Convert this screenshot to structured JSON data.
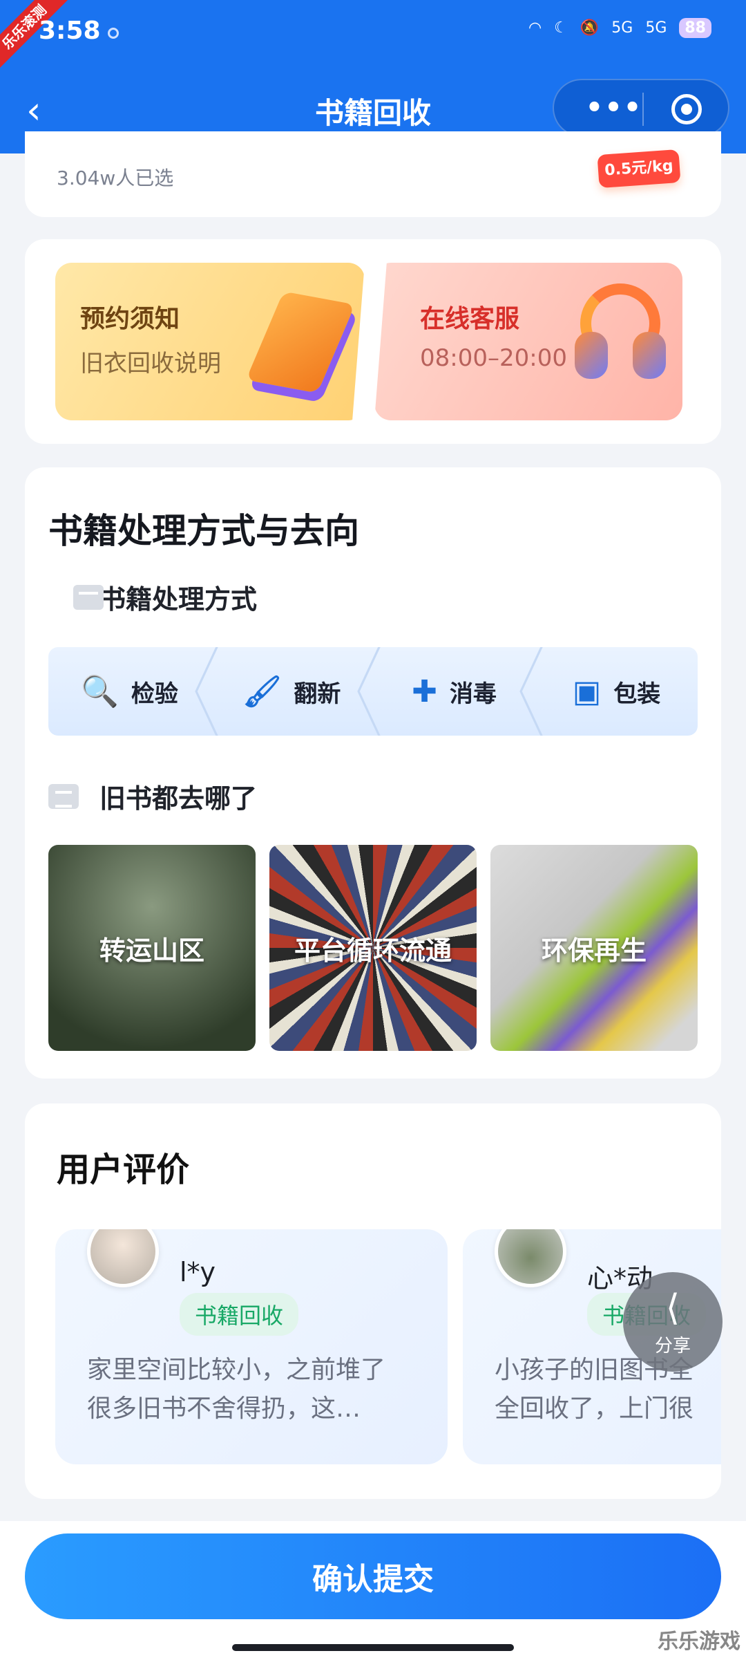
{
  "status": {
    "time": "3:58",
    "badge": "乐乐滚测",
    "net1": "5G",
    "net2": "5G",
    "battery": "88"
  },
  "nav": {
    "title": "书籍回收"
  },
  "top_card": {
    "count_text": "3.04w人已选",
    "price_text": "0.5元/kg"
  },
  "services": {
    "notice_title": "预约须知",
    "notice_sub": "旧衣回收说明",
    "service_title": "在线客服",
    "service_sub": "08:00–20:00"
  },
  "processing": {
    "section_title": "书籍处理方式与去向",
    "method_title": "书籍处理方式",
    "steps": [
      "检验",
      "翻新",
      "消毒",
      "包装"
    ],
    "where_title": "旧书都去哪了",
    "destinations": [
      "转运山区",
      "平台循环流通",
      "环保再生"
    ]
  },
  "reviews": {
    "title": "用户评价",
    "items": [
      {
        "name": "l*y",
        "tag": "书籍回收",
        "line1": "家里空间比较小，之前堆了",
        "line2": "很多旧书不舍得扔，这…"
      },
      {
        "name": "心*动",
        "tag": "书籍回收",
        "line1": "小孩子的旧图书全",
        "line2": "全回收了，上门很"
      }
    ]
  },
  "fab": {
    "label": "分享"
  },
  "submit": {
    "label": "确认提交"
  },
  "watermark": "乐乐游戏"
}
